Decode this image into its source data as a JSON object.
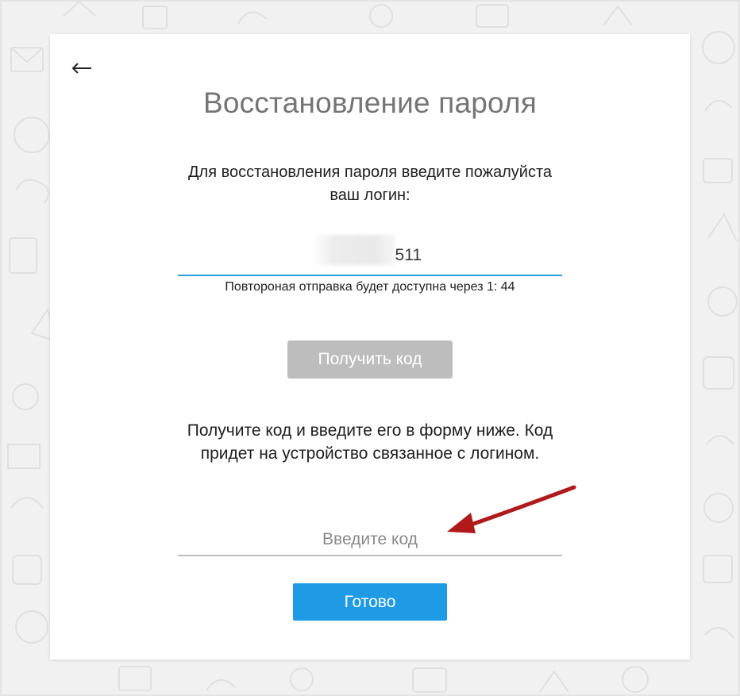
{
  "header": {
    "back_icon": "left-arrow-icon",
    "title": "Восстановление пароля"
  },
  "login_step": {
    "instruction": "Для восстановления пароля введите пожалуйста ваш логин:",
    "login_value": "511",
    "resend_note": "Повтороная отправка будет доступна через 1: 44",
    "get_code_label": "Получить код"
  },
  "code_step": {
    "instruction": "Получите код и введите его в форму ниже. Код придет на устройство связанное с логином.",
    "code_placeholder": "Введите код",
    "done_label": "Готово"
  },
  "colors": {
    "accent": "#1e9be4",
    "active_underline": "#2a9fd8",
    "disabled_button": "#bdbdbd",
    "annotation_arrow": "#b01a1a"
  }
}
